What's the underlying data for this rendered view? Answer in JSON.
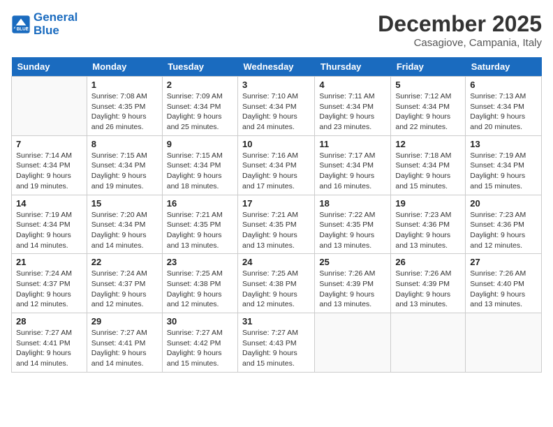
{
  "header": {
    "logo_line1": "General",
    "logo_line2": "Blue",
    "month_title": "December 2025",
    "location": "Casagiove, Campania, Italy"
  },
  "days_of_week": [
    "Sunday",
    "Monday",
    "Tuesday",
    "Wednesday",
    "Thursday",
    "Friday",
    "Saturday"
  ],
  "weeks": [
    [
      {
        "day": "",
        "sunrise": "",
        "sunset": "",
        "daylight": ""
      },
      {
        "day": "1",
        "sunrise": "Sunrise: 7:08 AM",
        "sunset": "Sunset: 4:35 PM",
        "daylight": "Daylight: 9 hours and 26 minutes."
      },
      {
        "day": "2",
        "sunrise": "Sunrise: 7:09 AM",
        "sunset": "Sunset: 4:34 PM",
        "daylight": "Daylight: 9 hours and 25 minutes."
      },
      {
        "day": "3",
        "sunrise": "Sunrise: 7:10 AM",
        "sunset": "Sunset: 4:34 PM",
        "daylight": "Daylight: 9 hours and 24 minutes."
      },
      {
        "day": "4",
        "sunrise": "Sunrise: 7:11 AM",
        "sunset": "Sunset: 4:34 PM",
        "daylight": "Daylight: 9 hours and 23 minutes."
      },
      {
        "day": "5",
        "sunrise": "Sunrise: 7:12 AM",
        "sunset": "Sunset: 4:34 PM",
        "daylight": "Daylight: 9 hours and 22 minutes."
      },
      {
        "day": "6",
        "sunrise": "Sunrise: 7:13 AM",
        "sunset": "Sunset: 4:34 PM",
        "daylight": "Daylight: 9 hours and 20 minutes."
      }
    ],
    [
      {
        "day": "7",
        "sunrise": "Sunrise: 7:14 AM",
        "sunset": "Sunset: 4:34 PM",
        "daylight": "Daylight: 9 hours and 19 minutes."
      },
      {
        "day": "8",
        "sunrise": "Sunrise: 7:15 AM",
        "sunset": "Sunset: 4:34 PM",
        "daylight": "Daylight: 9 hours and 19 minutes."
      },
      {
        "day": "9",
        "sunrise": "Sunrise: 7:15 AM",
        "sunset": "Sunset: 4:34 PM",
        "daylight": "Daylight: 9 hours and 18 minutes."
      },
      {
        "day": "10",
        "sunrise": "Sunrise: 7:16 AM",
        "sunset": "Sunset: 4:34 PM",
        "daylight": "Daylight: 9 hours and 17 minutes."
      },
      {
        "day": "11",
        "sunrise": "Sunrise: 7:17 AM",
        "sunset": "Sunset: 4:34 PM",
        "daylight": "Daylight: 9 hours and 16 minutes."
      },
      {
        "day": "12",
        "sunrise": "Sunrise: 7:18 AM",
        "sunset": "Sunset: 4:34 PM",
        "daylight": "Daylight: 9 hours and 15 minutes."
      },
      {
        "day": "13",
        "sunrise": "Sunrise: 7:19 AM",
        "sunset": "Sunset: 4:34 PM",
        "daylight": "Daylight: 9 hours and 15 minutes."
      }
    ],
    [
      {
        "day": "14",
        "sunrise": "Sunrise: 7:19 AM",
        "sunset": "Sunset: 4:34 PM",
        "daylight": "Daylight: 9 hours and 14 minutes."
      },
      {
        "day": "15",
        "sunrise": "Sunrise: 7:20 AM",
        "sunset": "Sunset: 4:34 PM",
        "daylight": "Daylight: 9 hours and 14 minutes."
      },
      {
        "day": "16",
        "sunrise": "Sunrise: 7:21 AM",
        "sunset": "Sunset: 4:35 PM",
        "daylight": "Daylight: 9 hours and 13 minutes."
      },
      {
        "day": "17",
        "sunrise": "Sunrise: 7:21 AM",
        "sunset": "Sunset: 4:35 PM",
        "daylight": "Daylight: 9 hours and 13 minutes."
      },
      {
        "day": "18",
        "sunrise": "Sunrise: 7:22 AM",
        "sunset": "Sunset: 4:35 PM",
        "daylight": "Daylight: 9 hours and 13 minutes."
      },
      {
        "day": "19",
        "sunrise": "Sunrise: 7:23 AM",
        "sunset": "Sunset: 4:36 PM",
        "daylight": "Daylight: 9 hours and 13 minutes."
      },
      {
        "day": "20",
        "sunrise": "Sunrise: 7:23 AM",
        "sunset": "Sunset: 4:36 PM",
        "daylight": "Daylight: 9 hours and 12 minutes."
      }
    ],
    [
      {
        "day": "21",
        "sunrise": "Sunrise: 7:24 AM",
        "sunset": "Sunset: 4:37 PM",
        "daylight": "Daylight: 9 hours and 12 minutes."
      },
      {
        "day": "22",
        "sunrise": "Sunrise: 7:24 AM",
        "sunset": "Sunset: 4:37 PM",
        "daylight": "Daylight: 9 hours and 12 minutes."
      },
      {
        "day": "23",
        "sunrise": "Sunrise: 7:25 AM",
        "sunset": "Sunset: 4:38 PM",
        "daylight": "Daylight: 9 hours and 12 minutes."
      },
      {
        "day": "24",
        "sunrise": "Sunrise: 7:25 AM",
        "sunset": "Sunset: 4:38 PM",
        "daylight": "Daylight: 9 hours and 12 minutes."
      },
      {
        "day": "25",
        "sunrise": "Sunrise: 7:26 AM",
        "sunset": "Sunset: 4:39 PM",
        "daylight": "Daylight: 9 hours and 13 minutes."
      },
      {
        "day": "26",
        "sunrise": "Sunrise: 7:26 AM",
        "sunset": "Sunset: 4:39 PM",
        "daylight": "Daylight: 9 hours and 13 minutes."
      },
      {
        "day": "27",
        "sunrise": "Sunrise: 7:26 AM",
        "sunset": "Sunset: 4:40 PM",
        "daylight": "Daylight: 9 hours and 13 minutes."
      }
    ],
    [
      {
        "day": "28",
        "sunrise": "Sunrise: 7:27 AM",
        "sunset": "Sunset: 4:41 PM",
        "daylight": "Daylight: 9 hours and 14 minutes."
      },
      {
        "day": "29",
        "sunrise": "Sunrise: 7:27 AM",
        "sunset": "Sunset: 4:41 PM",
        "daylight": "Daylight: 9 hours and 14 minutes."
      },
      {
        "day": "30",
        "sunrise": "Sunrise: 7:27 AM",
        "sunset": "Sunset: 4:42 PM",
        "daylight": "Daylight: 9 hours and 15 minutes."
      },
      {
        "day": "31",
        "sunrise": "Sunrise: 7:27 AM",
        "sunset": "Sunset: 4:43 PM",
        "daylight": "Daylight: 9 hours and 15 minutes."
      },
      {
        "day": "",
        "sunrise": "",
        "sunset": "",
        "daylight": ""
      },
      {
        "day": "",
        "sunrise": "",
        "sunset": "",
        "daylight": ""
      },
      {
        "day": "",
        "sunrise": "",
        "sunset": "",
        "daylight": ""
      }
    ]
  ]
}
